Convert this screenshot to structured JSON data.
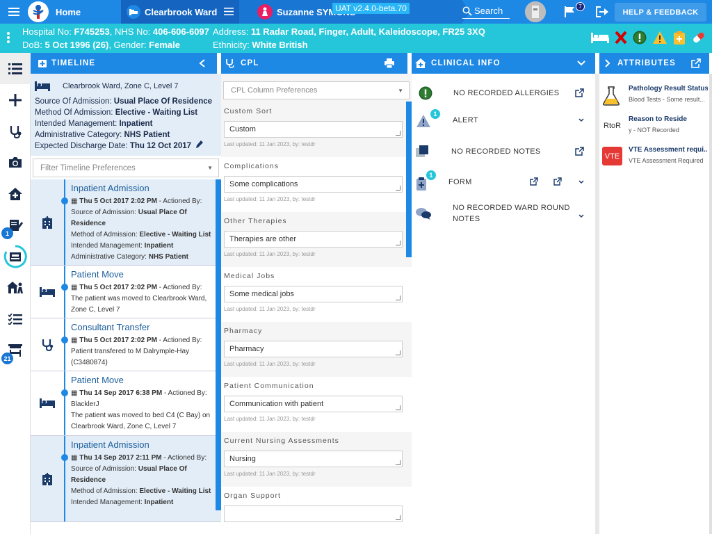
{
  "topbar": {
    "home_label": "Home",
    "ward_label": "Clearbrook Ward",
    "patient_name": "Suzanne SYMONS",
    "version": "UAT v2.4.0-beta.70",
    "search_label": "Search",
    "flag_count": "7",
    "help_label": "HELP & FEEDBACK"
  },
  "patient": {
    "hospital_no_label": "Hospital No:",
    "hospital_no": "F745253",
    "nhs_no_label": "NHS No:",
    "nhs_no": "406-606-6097",
    "dob_label": "DoB:",
    "dob": "5 Oct 1996 (26)",
    "gender_label": "Gender:",
    "gender": "Female",
    "address_label": "Address:",
    "address": "11 Radar Road, Finger, Adult, Kaleidoscope, FR25 3XQ",
    "ethnicity_label": "Ethnicity:",
    "ethnicity": "White British"
  },
  "sidenav": {
    "badge_notes": "1",
    "badge_beds": "21"
  },
  "timeline": {
    "title": "TIMELINE",
    "location": "Clearbrook Ward, Zone C, Level 7",
    "source_label": "Source Of Admission:",
    "source": "Usual Place Of Residence",
    "method_label": "Method Of Admission:",
    "method": "Elective - Waiting List",
    "mgmt_label": "Intended Management:",
    "mgmt": "Inpatient",
    "admin_label": "Administrative Category:",
    "admin": "NHS Patient",
    "discharge_label": "Expected Discharge Date:",
    "discharge": "Thu 12 Oct 2017",
    "filter_placeholder": "Filter Timeline Preferences",
    "items": [
      {
        "title": "Inpatient Admission",
        "date": "Thu 5 Oct 2017 2:02 PM",
        "actioned": " - Actioned By:",
        "l1a": "Source of Admission: ",
        "l1b": "Usual Place Of",
        "l2": "Residence",
        "l3a": "Method of Admission: ",
        "l3b": "Elective - Waiting List",
        "l4a": "Intended Management: ",
        "l4b": "Inpatient",
        "l5a": "Administrative Category: ",
        "l5b": "NHS Patient"
      },
      {
        "title": "Patient Move",
        "date": "Thu 5 Oct 2017 2:02 PM",
        "actioned": " - Actioned By:",
        "l1": "The patient was moved to Clearbrook Ward,",
        "l2": "Zone C, Level 7"
      },
      {
        "title": "Consultant Transfer",
        "date": "Thu 5 Oct 2017 2:02 PM",
        "actioned": " - Actioned By:",
        "l1": "Patient transfered to M Dalrymple-Hay",
        "l2": "(C3480874)"
      },
      {
        "title": "Patient Move",
        "date": "Thu 14 Sep 2017 6:38 PM",
        "actioned": " - Actioned By:",
        "l0": "BlacklerJ",
        "l1": "The patient was moved to bed C4 (C Bay) on",
        "l2": "Clearbrook Ward, Zone C, Level 7"
      },
      {
        "title": "Inpatient Admission",
        "date": "Thu 14 Sep 2017 2:11 PM",
        "actioned": " - Actioned By:",
        "l1a": "Source of Admission: ",
        "l1b": "Usual Place Of",
        "l2": "Residence",
        "l3a": "Method of Admission: ",
        "l3b": "Elective - Waiting List",
        "l4a": "Intended Management: ",
        "l4b": "Inpatient"
      }
    ]
  },
  "cpl": {
    "title": "CPL",
    "pref_placeholder": "CPL Column Preferences",
    "sections": [
      {
        "label": "Custom Sort",
        "value": "Custom",
        "updated": "Last updated: 11 Jan 2023, by: testdr"
      },
      {
        "label": "Complications",
        "value": "Some complications",
        "updated": "Last updated: 11 Jan 2023, by: testdr"
      },
      {
        "label": "Other Therapies",
        "value": "Therapies are other",
        "updated": "Last updated: 11 Jan 2023, by: testdr"
      },
      {
        "label": "Medical Jobs",
        "value": "Some medical jobs",
        "updated": "Last updated: 11 Jan 2023, by: testdr"
      },
      {
        "label": "Pharmacy",
        "value": "Pharmacy",
        "updated": "Last updated: 11 Jan 2023, by: testdr"
      },
      {
        "label": "Patient Communication",
        "value": "Communication with patient",
        "updated": "Last updated: 11 Jan 2023, by: testdr"
      },
      {
        "label": "Current Nursing Assessments",
        "value": "Nursing",
        "updated": "Last updated: 11 Jan 2023, by: testdr"
      },
      {
        "label": "Organ Support",
        "value": "",
        "updated": ""
      }
    ]
  },
  "clinical": {
    "title": "CLINICAL INFO",
    "allergies": "NO RECORDED ALLERGIES",
    "alert": "ALERT",
    "alert_count": "1",
    "notes": "NO RECORDED NOTES",
    "form": "FORM",
    "form_count": "1",
    "ward_round_1": "NO RECORDED WARD ROUND",
    "ward_round_2": "NOTES"
  },
  "attributes": {
    "title": "ATTRIBUTES",
    "items": [
      {
        "title": "Pathology Result Status",
        "sub": "Blood Tests - Some result..."
      },
      {
        "icon_text": "RtoR",
        "title": "Reason to Reside",
        "sub": "y - NOT Recorded"
      },
      {
        "icon_text": "VTE",
        "title": "VTE Assessment requi...",
        "sub": "VTE Assessment Required"
      }
    ]
  },
  "colors": {
    "primary": "#1e88e5",
    "patient_bar": "#26c6da",
    "timeline_bg": "#e3edf7",
    "vte_red": "#e53935"
  }
}
